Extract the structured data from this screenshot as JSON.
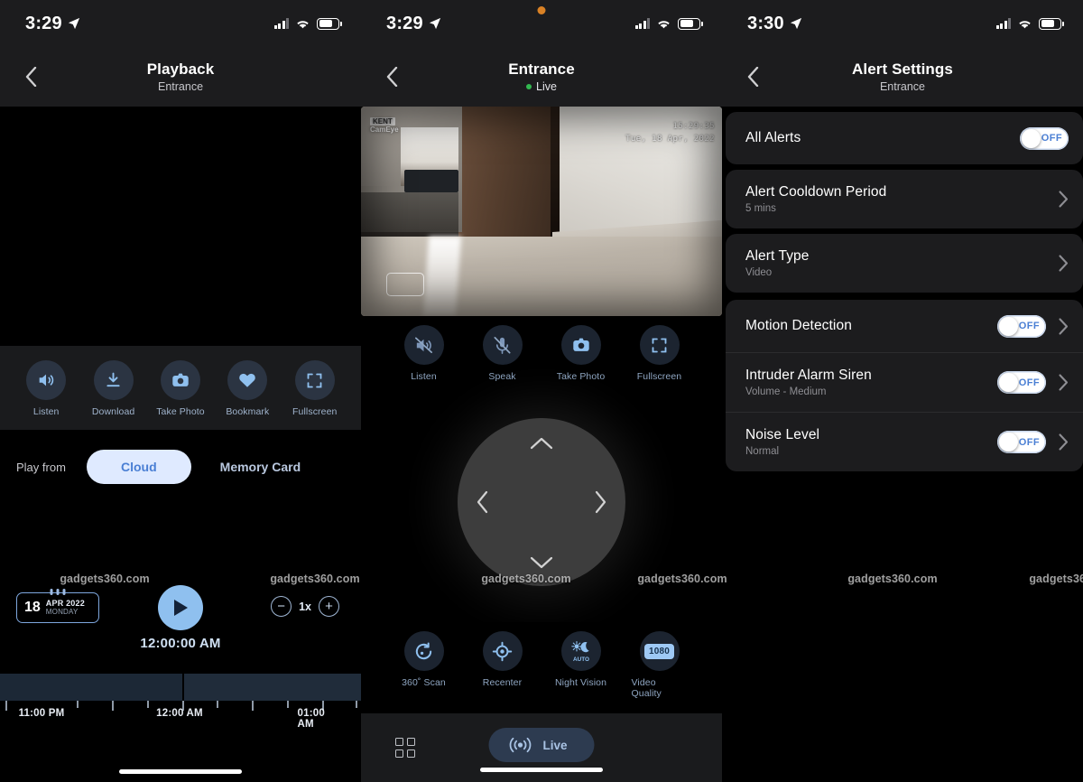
{
  "panels": {
    "playback": {
      "status": {
        "time": "3:29",
        "location_icon": "location-arrow-icon",
        "signal_icon": "cellular-signal-icon",
        "wifi_icon": "wifi-icon",
        "battery_icon": "battery-icon"
      },
      "nav": {
        "back_icon": "chevron-left-icon",
        "title": "Playback",
        "subtitle": "Entrance"
      },
      "actions": [
        {
          "label": "Listen",
          "icon": "speaker-icon"
        },
        {
          "label": "Download",
          "icon": "download-icon"
        },
        {
          "label": "Take Photo",
          "icon": "camera-icon"
        },
        {
          "label": "Bookmark",
          "icon": "heart-icon"
        },
        {
          "label": "Fullscreen",
          "icon": "fullscreen-icon"
        }
      ],
      "play_from": {
        "label": "Play from",
        "selected": "Cloud",
        "other": "Memory Card"
      },
      "transport": {
        "date_day": "18",
        "date_month_year": "APR 2022",
        "date_weekday": "MONDAY",
        "play_icon": "play-icon",
        "current_time": "12:00:00 AM",
        "minus": "−",
        "speed": "1x",
        "plus": "+"
      },
      "timeline": {
        "labels": [
          "11:00 PM",
          "12:00 AM",
          "01:00 AM"
        ]
      }
    },
    "live": {
      "status": {
        "time": "3:29",
        "rec_dot_color": "#d98125"
      },
      "nav": {
        "back_icon": "chevron-left-icon",
        "title": "Entrance",
        "subtitle": "Live",
        "live_dot_color": "#32b850"
      },
      "video": {
        "logo_brand": "KENT",
        "logo_product": "CamEye",
        "timestamp_time": "15:29:35",
        "timestamp_date": "Tue, 18 Apr, 2022"
      },
      "actions": [
        {
          "label": "Listen",
          "icon": "speaker-muted-icon"
        },
        {
          "label": "Speak",
          "icon": "microphone-muted-icon"
        },
        {
          "label": "Take Photo",
          "icon": "camera-icon"
        },
        {
          "label": "Fullscreen",
          "icon": "fullscreen-icon"
        }
      ],
      "pan_pad": {
        "up": "chevron-up-icon",
        "down": "chevron-down-icon",
        "left": "chevron-left-icon",
        "right": "chevron-right-icon"
      },
      "features": [
        {
          "label": "360˚ Scan",
          "icon": "rotate-360-icon"
        },
        {
          "label": "Recenter",
          "icon": "crosshair-icon"
        },
        {
          "label": "Night Vision",
          "icon": "night-vision-icon",
          "badge": "AUTO"
        },
        {
          "label": "Video Quality",
          "icon": "resolution-icon",
          "badge": "1080"
        }
      ],
      "tabbar": {
        "grid_icon": "grid-view-icon",
        "live_icon": "live-broadcast-icon",
        "live_label": "Live"
      }
    },
    "alerts": {
      "status": {
        "time": "3:30"
      },
      "nav": {
        "back_icon": "chevron-left-icon",
        "title": "Alert Settings",
        "subtitle": "Entrance"
      },
      "rows": [
        {
          "title": "All Alerts",
          "sub": "",
          "toggle": "OFF",
          "chevron": false
        },
        {
          "title": "Alert Cooldown Period",
          "sub": "5 mins",
          "toggle": null,
          "chevron": true
        },
        {
          "title": "Alert Type",
          "sub": "Video",
          "toggle": null,
          "chevron": true
        },
        {
          "title": "Motion Detection",
          "sub": "",
          "toggle": "OFF",
          "chevron": true
        },
        {
          "title": "Intruder Alarm Siren",
          "sub": "Volume - Medium",
          "toggle": "OFF",
          "chevron": true
        },
        {
          "title": "Noise Level",
          "sub": "Normal",
          "toggle": "OFF",
          "chevron": true
        }
      ]
    }
  },
  "watermark": {
    "text": "gadgets360.com",
    "positions": [
      116,
      349,
      583,
      756,
      989,
      1190
    ]
  },
  "colors": {
    "accent_blue": "#8fc0ef",
    "toggle_text": "#4a7fd4",
    "live_green": "#32b850",
    "rec_orange": "#d98125",
    "card_bg": "#1c1c1e"
  }
}
